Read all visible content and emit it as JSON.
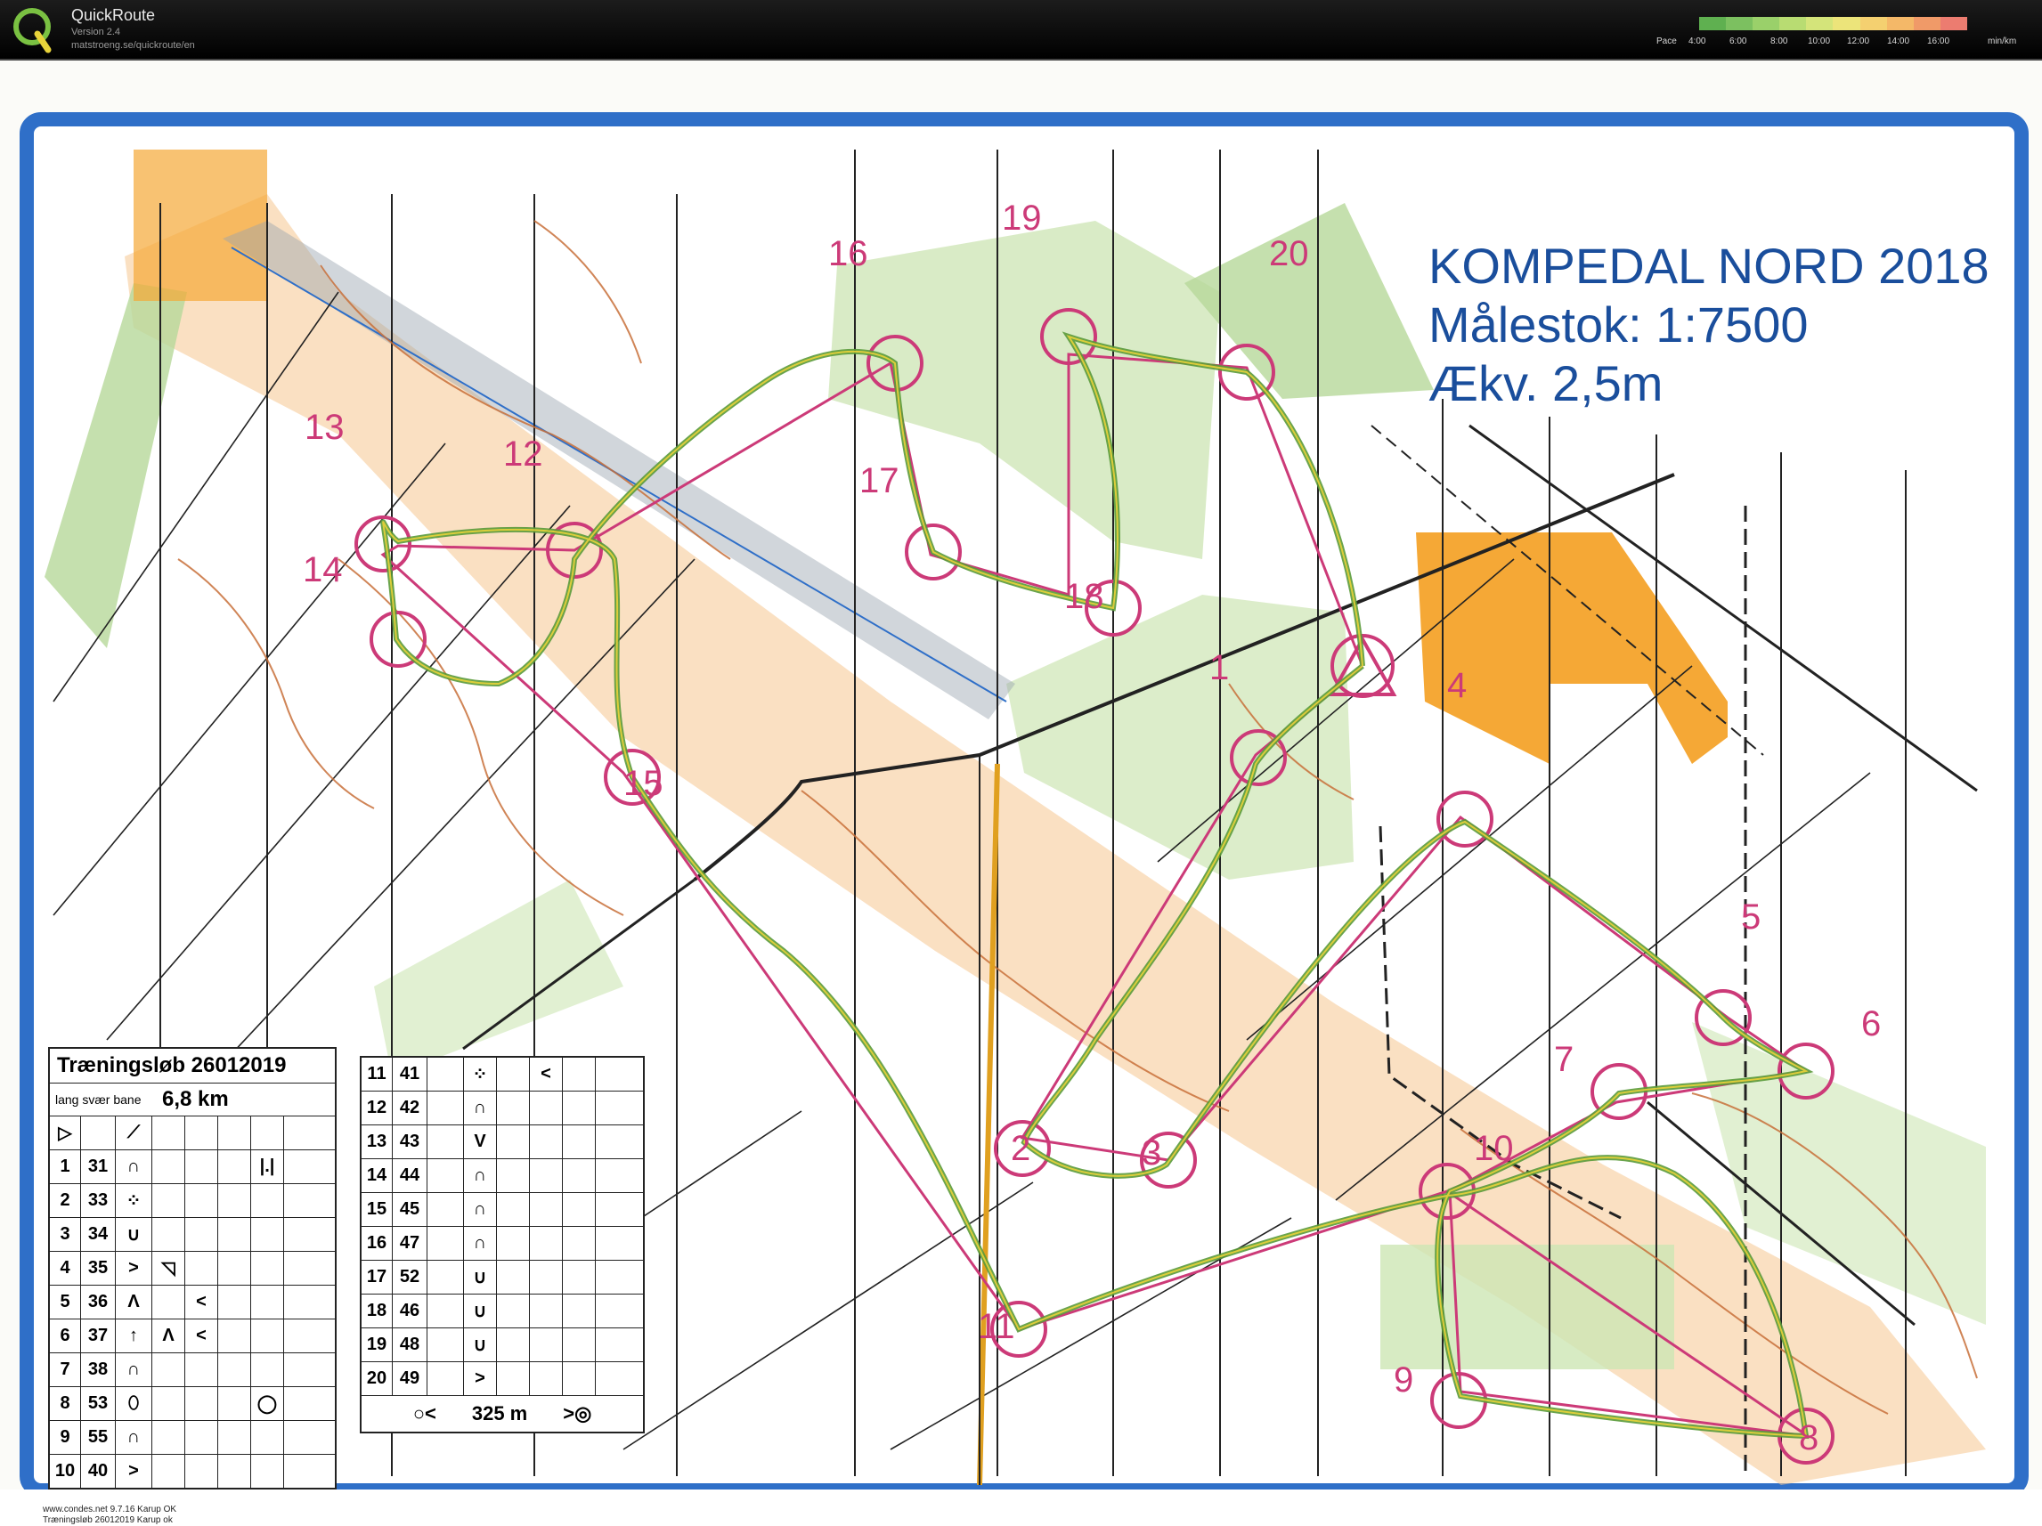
{
  "app": {
    "title": "QuickRoute",
    "version": "Version 2.4",
    "url": "matstroeng.se/quickroute/en",
    "logo_icon": "q-logo-icon",
    "pace_label": "Pace",
    "pace_unit": "min/km",
    "pace_ticks": [
      "4:00",
      "6:00",
      "8:00",
      "10:00",
      "12:00",
      "14:00",
      "16:00"
    ]
  },
  "map": {
    "title_lines": [
      "KOMPEDAL NORD 2018",
      "Målestok: 1:7500",
      "Ækv. 2,5m"
    ],
    "controls": [
      "1",
      "2",
      "3",
      "4",
      "5",
      "6",
      "7",
      "8",
      "9",
      "10",
      "11",
      "12",
      "13",
      "14",
      "15",
      "16",
      "17",
      "18",
      "19",
      "20"
    ],
    "colors": {
      "course": "#cc3a78",
      "route": "#5a9a3a",
      "frame": "#2f6fc8",
      "contour": "#c8703a",
      "open": "#f4b46a",
      "green": "#b6d89a"
    }
  },
  "description": {
    "event": "Træningsløb 26012019",
    "course": "lang svær bane",
    "length": "6,8 km",
    "left_rows": [
      {
        "n": "1",
        "code": "31"
      },
      {
        "n": "2",
        "code": "33"
      },
      {
        "n": "3",
        "code": "34"
      },
      {
        "n": "4",
        "code": "35"
      },
      {
        "n": "5",
        "code": "36"
      },
      {
        "n": "6",
        "code": "37"
      },
      {
        "n": "7",
        "code": "38"
      },
      {
        "n": "8",
        "code": "53"
      },
      {
        "n": "9",
        "code": "55"
      },
      {
        "n": "10",
        "code": "40"
      }
    ],
    "right_rows": [
      {
        "n": "11",
        "code": "41"
      },
      {
        "n": "12",
        "code": "42"
      },
      {
        "n": "13",
        "code": "43"
      },
      {
        "n": "14",
        "code": "44"
      },
      {
        "n": "15",
        "code": "45"
      },
      {
        "n": "16",
        "code": "47"
      },
      {
        "n": "17",
        "code": "52"
      },
      {
        "n": "18",
        "code": "46"
      },
      {
        "n": "19",
        "code": "48"
      },
      {
        "n": "20",
        "code": "49"
      }
    ],
    "finish_distance": "325 m",
    "footer_line1": "www.condes.net 9.7.16 Karup OK",
    "footer_line2": "Træningsløb 26012019 Karup ok"
  }
}
